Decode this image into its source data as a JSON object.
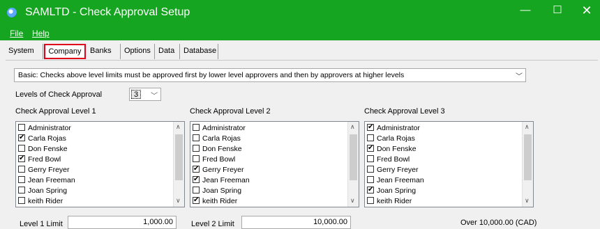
{
  "window": {
    "title": "SAMLTD - Check Approval Setup",
    "minimize": "—",
    "maximize": "☐",
    "close": "✕"
  },
  "menu": {
    "file": "File",
    "help": "Help"
  },
  "tabs": [
    "System",
    "Company",
    "Banks",
    "Options",
    "Data",
    "Database"
  ],
  "selected_tab": "Company",
  "highlight_color": "#e0001b",
  "titlebar_color": "#16a520",
  "approval_mode": {
    "selected": "Basic: Checks above level limits must be approved first by lower level approvers and then by approvers at higher levels"
  },
  "levels": {
    "label": "Levels of Check Approval",
    "value": "3"
  },
  "columns": [
    {
      "title": "Check Approval Level 1",
      "items": [
        {
          "name": "Administrator",
          "checked": false
        },
        {
          "name": "Carla Rojas",
          "checked": true
        },
        {
          "name": "Don Fenske",
          "checked": false
        },
        {
          "name": "Fred Bowl",
          "checked": true
        },
        {
          "name": "Gerry Freyer",
          "checked": false
        },
        {
          "name": "Jean Freeman",
          "checked": false
        },
        {
          "name": "Joan Spring",
          "checked": false
        },
        {
          "name": "keith Rider",
          "checked": false
        }
      ]
    },
    {
      "title": "Check Approval Level 2",
      "items": [
        {
          "name": "Administrator",
          "checked": false
        },
        {
          "name": "Carla Rojas",
          "checked": false
        },
        {
          "name": "Don Fenske",
          "checked": false
        },
        {
          "name": "Fred Bowl",
          "checked": false
        },
        {
          "name": "Gerry Freyer",
          "checked": true
        },
        {
          "name": "Jean Freeman",
          "checked": true
        },
        {
          "name": "Joan Spring",
          "checked": false
        },
        {
          "name": "keith Rider",
          "checked": true
        }
      ]
    },
    {
      "title": "Check Approval Level 3",
      "items": [
        {
          "name": "Administrator",
          "checked": true
        },
        {
          "name": "Carla Rojas",
          "checked": false
        },
        {
          "name": "Don Fenske",
          "checked": true
        },
        {
          "name": "Fred Bowl",
          "checked": false
        },
        {
          "name": "Gerry Freyer",
          "checked": false
        },
        {
          "name": "Jean Freeman",
          "checked": false
        },
        {
          "name": "Joan Spring",
          "checked": true
        },
        {
          "name": "keith Rider",
          "checked": false
        }
      ]
    }
  ],
  "limits": {
    "level1_label": "Level 1 Limit",
    "level1_value": "1,000.00",
    "level2_label": "Level 2 Limit",
    "level2_value": "10,000.00",
    "over_text": "Over 10,000.00 (CAD)"
  },
  "icons": {
    "dropdown": "chevron-down-icon",
    "scroll_up": "scroll-up-icon",
    "scroll_down": "scroll-down-icon",
    "app": "app-icon"
  }
}
